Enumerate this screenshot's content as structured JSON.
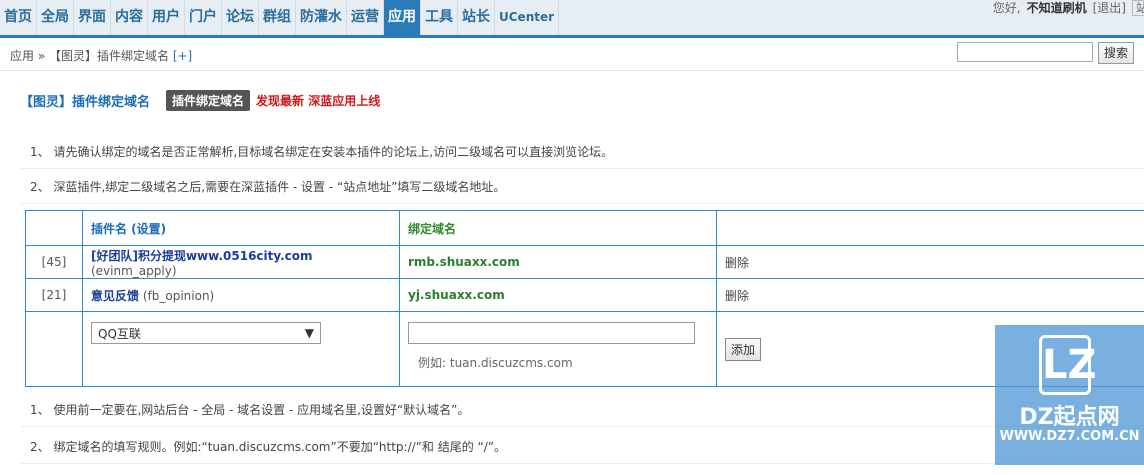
{
  "nav": {
    "items": [
      "首页",
      "全局",
      "界面",
      "内容",
      "用户",
      "门户",
      "论坛",
      "群组",
      "防灌水",
      "运营",
      "应用",
      "工具",
      "站长",
      "UCenter"
    ],
    "active_index": 10
  },
  "user": {
    "greeting": "您好,",
    "name": "不知道刷机",
    "logout": "[退出]",
    "cut": "站"
  },
  "breadcrumb": {
    "text": "应用 » 【图灵】插件绑定域名",
    "add": "[+]"
  },
  "search": {
    "button": "搜索",
    "value": ""
  },
  "title": {
    "main": "【图灵】插件绑定域名",
    "tag": "插件绑定域名",
    "promo": "发现最新 深蓝应用上线"
  },
  "tips_top": [
    "1、 请先确认绑定的域名是否正常解析,目标域名绑定在安装本插件的论坛上,访问二级域名可以直接浏览论坛。",
    "2、 深蓝插件,绑定二级域名之后,需要在深蓝插件 - 设置 - “站点地址”填写二级域名地址。"
  ],
  "table": {
    "headers": {
      "name": "插件名 (设置)",
      "domain": "绑定域名"
    },
    "rows": [
      {
        "id": "[45]",
        "name": "[好团队]积分提现www.0516city.com",
        "plugin_id": "(evinm_apply)",
        "domain": "rmb.shuaxx.com",
        "action": "删除"
      },
      {
        "id": "[21]",
        "name": "意见反馈",
        "plugin_id": "(fb_opinion)",
        "domain": "yj.shuaxx.com",
        "action": "删除"
      }
    ],
    "new_row": {
      "select_value": "QQ互联",
      "input_value": "",
      "example": "例如: tuan.discuzcms.com",
      "add_button": "添加"
    }
  },
  "tips_bottom": [
    "1、 使用前一定要在,网站后台 - 全局 - 域名设置 - 应用域名里,设置好“默认域名”。",
    "2、 绑定域名的填写规则。例如:“tuan.discuzcms.com”不要加“http://”和 结尾的 “/”。"
  ],
  "watermark": {
    "logo": "LZ",
    "brand": "DZ起点网",
    "url": "WWW.DZ7.COM.CN"
  },
  "colors": {
    "accent": "#2b7bb8",
    "title": "#1b6db5",
    "promo": "#d21818",
    "domain": "#2e7d2e"
  }
}
